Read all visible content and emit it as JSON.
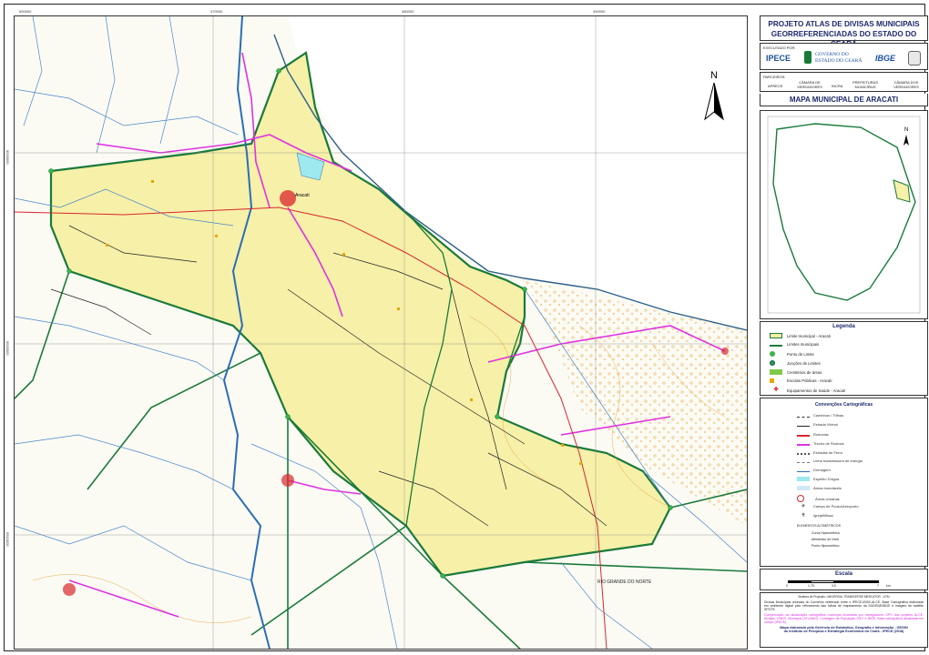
{
  "header": {
    "title_line1": "PROJETO ATLAS DE DIVISAS MUNICIPAIS",
    "title_line2": "GEORREFERENCIADAS DO ESTADO DO CEARÁ",
    "executor_label": "EXECUTADO POR:",
    "logo_ipece": "IPECE",
    "logo_governo_line1": "GOVERNO DO",
    "logo_governo_line2": "ESTADO DO CEARÁ",
    "logo_ibge": "IBGE",
    "partners_label": "PARCEIROS:",
    "partners": [
      "APRECE",
      "CÂMARA DE VEREADORES",
      "INCRA",
      "PREFEITURAS MUNICIPAIS",
      "CÂMARA DOS VEREADORES",
      "CÂMARA DO CEARÁ"
    ],
    "north_letter": "N"
  },
  "map_title": "MAPA MUNICIPAL DE ARACATI",
  "legend": {
    "heading": "Legenda",
    "items": [
      {
        "label": "Limite municipal - Aracati",
        "color": "#f6f0a8"
      },
      {
        "label": "Limites municipais",
        "color": "#1a7a3a"
      },
      {
        "label": "Ponto de Limite",
        "color": "#3bb34a"
      },
      {
        "label": "Junções de Limites",
        "color": "#2e9e3e"
      },
      {
        "label": "Cemitérios de áreas",
        "color": "#7fc94a"
      },
      {
        "label": "Escolas Públicas - Aracati",
        "color": "#e6a800"
      },
      {
        "label": "Equipamentos de Saúde - Aracati",
        "color": "#d9262c"
      }
    ]
  },
  "conventions": {
    "heading": "Convenções Cartográficas",
    "items": [
      "Caminhos / Trilhas",
      "Estrada Vicinal",
      "Rodovias",
      "Trecho de Rodovia",
      "Estradas de Ferro",
      "Linha transmissora de energia",
      "Drenagem",
      "Espelho D'água",
      "Áreas Inundáveis",
      "Áreas Urbanas",
      "Campo de Pouso/Aeroporto",
      "Igreja/Missa"
    ],
    "extra_heading": "ELEMENTOS ALTIMÉTRICOS",
    "extra_items": [
      "Curva Hipsométrica",
      "Altimétrico de Nível",
      "Ponto Hipsométrico"
    ]
  },
  "scale": {
    "heading": "Escala",
    "ticks": [
      "0",
      "1,75",
      "3,5",
      "7",
      "km"
    ]
  },
  "notes": {
    "projection": "Sistema de Projeção: UNIVERSAL TRANSVERSE MERCATOR - UTM",
    "source": "Divisas Municipais oriundas do Convênio celebrado entre o IPECE-IBGE-ALCE. Base Cartográfica elaborada em ambiente digital pelo refinamento das folhas de mapeamento da SUDENE/IBGE e imagem de satélite SPOT5.",
    "update": "Complexação da atualização cartográfica municipal levantada por navegadores GPS dos projetos ALCE, Arraiais, DNER, Municipal (ATLANDI). Contagem da População 2007 e IBGE. Base cartográfica atualizada em campo (IPECE).",
    "credit_line1": "Mapa elaborado pela Gerência de Estatística, Geografia e Informação - GEGIN",
    "credit_line2": "do Instituto de Pesquisa e Estratégia Econômica do Ceará - IPECE (2018)"
  },
  "map_labels": {
    "rio_grande_do_norte": "RIO GRANDE DO NORTE",
    "aracati": "Aracati"
  },
  "coordinates": {
    "top": [
      "470000",
      "480000",
      "490000",
      "500000"
    ],
    "left": [
      "9530000",
      "9520000",
      "9510000"
    ]
  }
}
